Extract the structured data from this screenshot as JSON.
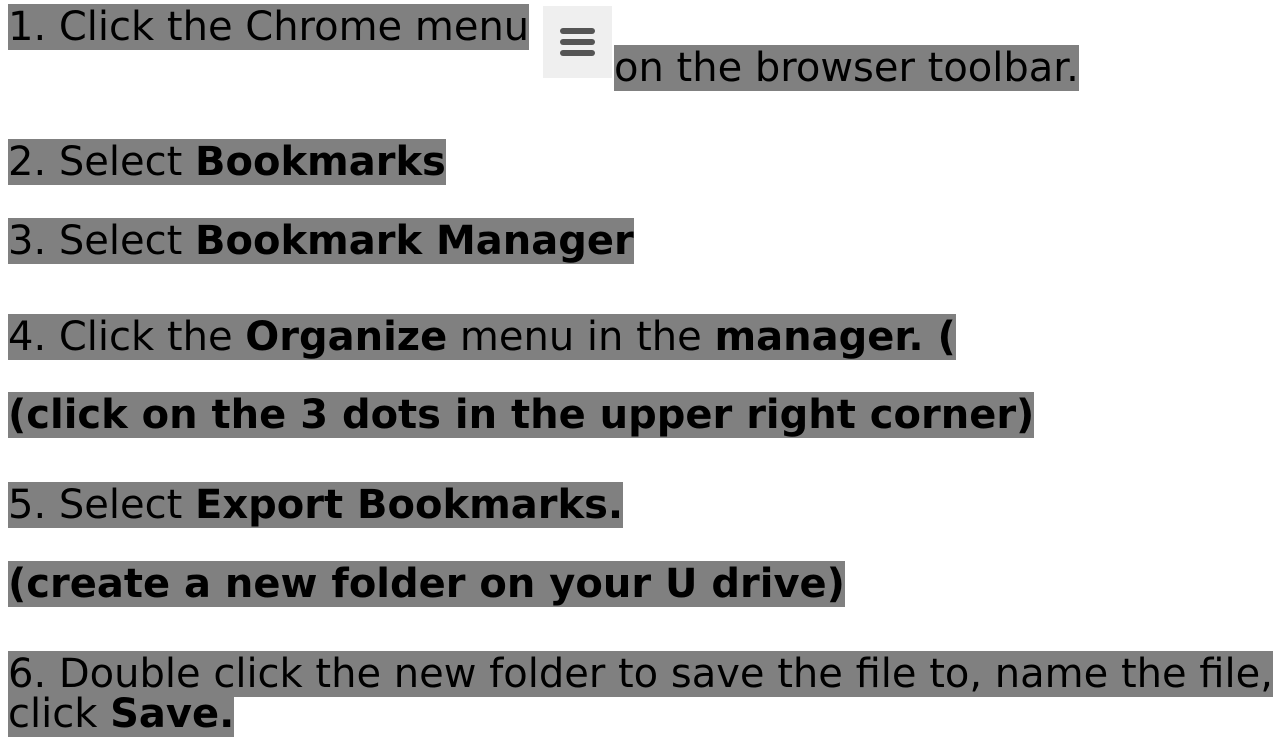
{
  "steps": {
    "s1": {
      "text_a": "1. Click the Chrome menu",
      "text_b": "on the browser toolbar.",
      "icon": "hamburger-menu-icon"
    },
    "s2": {
      "prefix": "2. Select ",
      "bold": "Bookmarks"
    },
    "s3": {
      "prefix": "3. Select ",
      "bold": "Bookmark Manager"
    },
    "s4": {
      "prefix": "4. Click the ",
      "bold1": "Organize",
      "middle": " menu in the ",
      "bold2": "manager. ("
    },
    "s4_note": "(click on the 3 dots in the upper right corner)",
    "s5": {
      "prefix": "5. Select ",
      "bold": "Export Bookmarks."
    },
    "s5_note": "(create a new folder on your U drive)",
    "s6": {
      "prefix": "6. Double click the new folder to save the file to, name the file, click ",
      "bold": "Save."
    }
  },
  "colors": {
    "highlight": "#808080",
    "icon_bg": "#efefef",
    "icon_bars": "#555555"
  }
}
